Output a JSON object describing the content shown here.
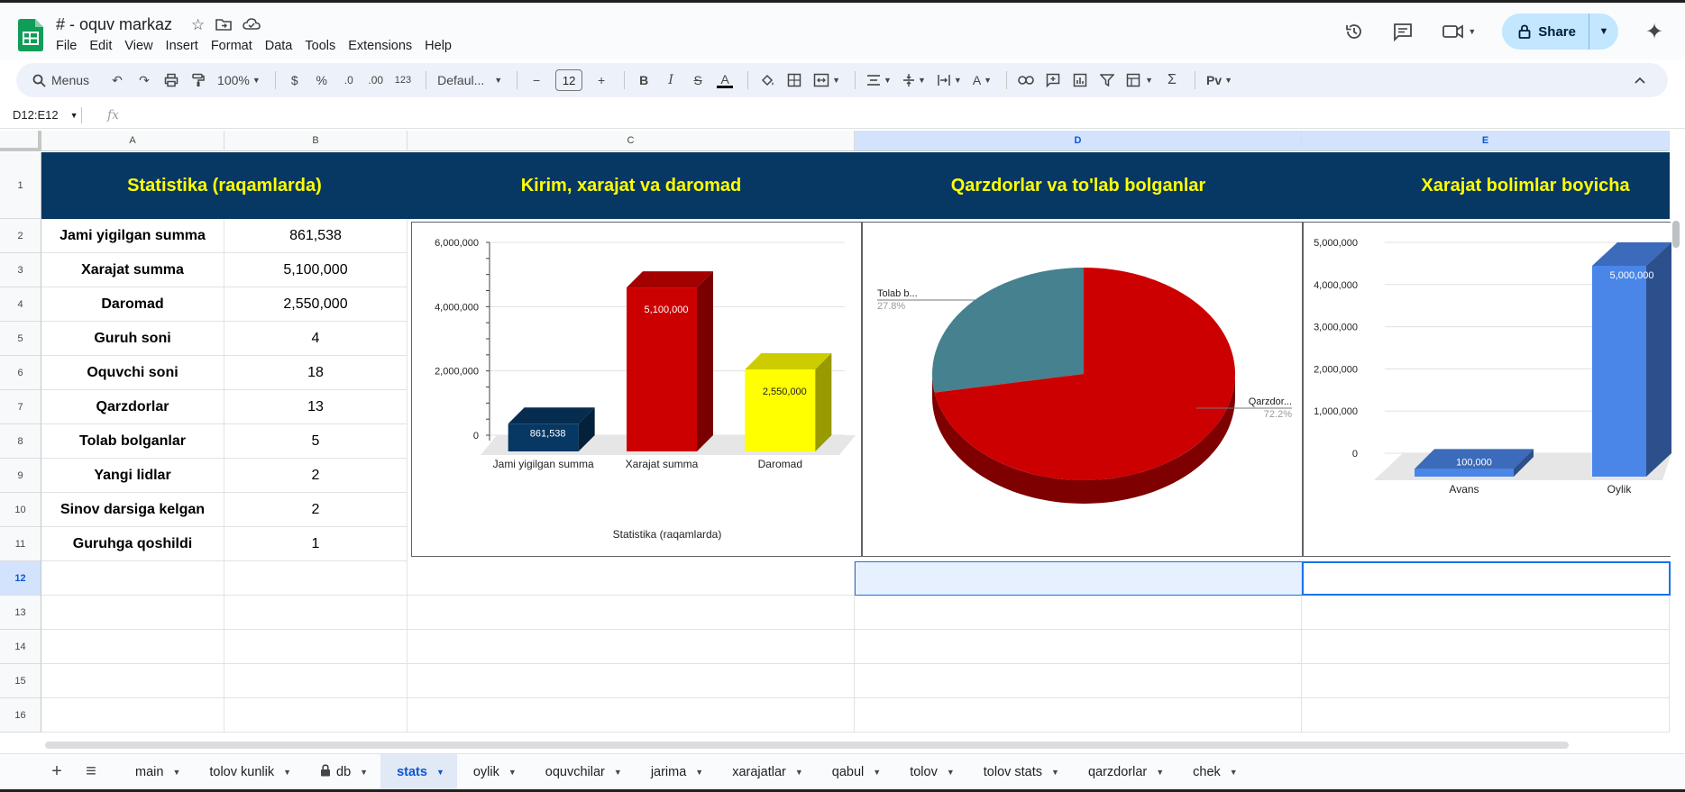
{
  "app": {
    "doc_title": "# - oquv markaz",
    "menus": [
      "File",
      "Edit",
      "View",
      "Insert",
      "Format",
      "Data",
      "Tools",
      "Extensions",
      "Help"
    ],
    "share_label": "Share",
    "icons": {
      "star": "star-icon",
      "move": "folder-move-icon",
      "cloud": "cloud-status-icon",
      "history": "history-icon",
      "comments": "comment-icon",
      "meet": "video-call-icon",
      "gemini": "sparkle-icon"
    }
  },
  "toolbar": {
    "search_label": "Menus",
    "zoom": "100%",
    "currency": "$",
    "percent": "%",
    "dec_decrease": ".0",
    "dec_increase": ".00",
    "number_format": "123",
    "font": "Defaul...",
    "font_size": "12"
  },
  "formula_bar": {
    "name_box": "D12:E12",
    "fx": "fx"
  },
  "columns": [
    "A",
    "B",
    "C",
    "D",
    "E"
  ],
  "rows": [
    "1",
    "2",
    "3",
    "4",
    "5",
    "6",
    "7",
    "8",
    "9",
    "10",
    "11",
    "12",
    "13",
    "14",
    "15",
    "16"
  ],
  "headers": {
    "stats_title": "Statistika (raqamlarda)",
    "chart1_title": "Kirim, xarajat va daromad",
    "chart2_title": "Qarzdorlar va to'lab bolganlar",
    "chart3_title": "Xarajat bolimlar boyicha"
  },
  "stats": [
    {
      "label": "Jami yigilgan summa",
      "value": "861,538"
    },
    {
      "label": "Xarajat summa",
      "value": "5,100,000"
    },
    {
      "label": "Daromad",
      "value": "2,550,000"
    },
    {
      "label": "Guruh soni",
      "value": "4"
    },
    {
      "label": "Oquvchi soni",
      "value": "18"
    },
    {
      "label": "Qarzdorlar",
      "value": "13"
    },
    {
      "label": "Tolab bolganlar",
      "value": "5"
    },
    {
      "label": "Yangi lidlar",
      "value": "2"
    },
    {
      "label": "Sinov darsiga kelgan",
      "value": "2"
    },
    {
      "label": "Guruhga qoshildi",
      "value": "1"
    }
  ],
  "chart_data": [
    {
      "type": "bar",
      "categories": [
        "Jami yigilgan summa",
        "Xarajat summa",
        "Daromad"
      ],
      "values": [
        861538,
        5100000,
        2550000
      ],
      "value_labels": [
        "861,538",
        "5,100,000",
        "2,550,000"
      ],
      "colors": [
        "#073763",
        "#cc0000",
        "#ffff00"
      ],
      "ylim": [
        0,
        6000000
      ],
      "yticks": [
        "6,000,000",
        "4,000,000",
        "2,000,000",
        "0"
      ],
      "xlabel": "Statistika (raqamlarda)",
      "title": ""
    },
    {
      "type": "pie",
      "labels": [
        "Tolab b...",
        "Qarzdor..."
      ],
      "values": [
        27.8,
        72.2
      ],
      "percent_labels": [
        "27.8%",
        "72.2%"
      ],
      "colors": [
        "#45818e",
        "#cc0000"
      ],
      "title": ""
    },
    {
      "type": "bar",
      "categories": [
        "Avans",
        "Oylik"
      ],
      "values": [
        100000,
        5000000
      ],
      "value_labels": [
        "100,000",
        "5,000,000"
      ],
      "colors": [
        "#4a86e8",
        "#4a86e8"
      ],
      "ylim": [
        0,
        5000000
      ],
      "yticks": [
        "5,000,000",
        "4,000,000",
        "3,000,000",
        "2,000,000",
        "1,000,000",
        "0"
      ],
      "title": ""
    }
  ],
  "sheets": {
    "add_icon": "plus-icon",
    "list_icon": "menu-icon",
    "tabs": [
      {
        "label": "main",
        "active": false,
        "locked": false
      },
      {
        "label": "tolov kunlik",
        "active": false,
        "locked": false
      },
      {
        "label": "db",
        "active": false,
        "locked": true
      },
      {
        "label": "stats",
        "active": true,
        "locked": false
      },
      {
        "label": "oylik",
        "active": false,
        "locked": false
      },
      {
        "label": "oquvchilar",
        "active": false,
        "locked": false
      },
      {
        "label": "jarima",
        "active": false,
        "locked": false
      },
      {
        "label": "xarajatlar",
        "active": false,
        "locked": false
      },
      {
        "label": "qabul",
        "active": false,
        "locked": false
      },
      {
        "label": "tolov",
        "active": false,
        "locked": false
      },
      {
        "label": "tolov stats",
        "active": false,
        "locked": false
      },
      {
        "label": "qarzdorlar",
        "active": false,
        "locked": false
      },
      {
        "label": "chek",
        "active": false,
        "locked": false
      }
    ]
  }
}
